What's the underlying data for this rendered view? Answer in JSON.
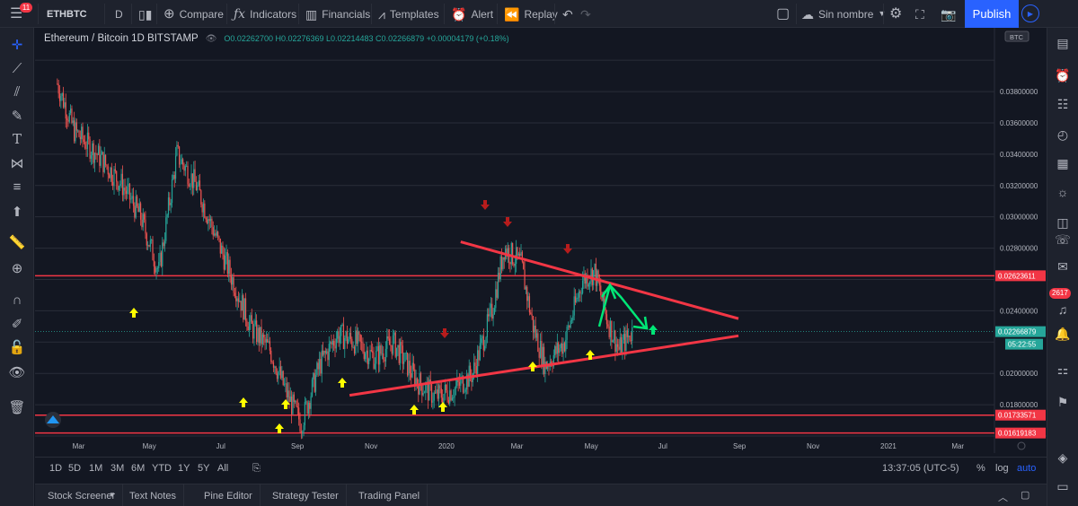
{
  "topbar": {
    "menu_badge": "11",
    "symbol": "ETHBTC",
    "interval": "D",
    "compare": "Compare",
    "indicators": "Indicators",
    "financials": "Financials",
    "templates": "Templates",
    "alert": "Alert",
    "replay": "Replay",
    "layout_name": "Sin nombre",
    "publish": "Publish"
  },
  "legend": {
    "title": "Ethereum / Bitcoin  1D  BITSTAMP",
    "ohlc": "O0.02262700  H0.02276369  L0.02214483  C0.02266879  +0.00004179 (+0.18%)"
  },
  "price_axis": {
    "currency_badge": "BTC",
    "ticks": [
      "0.03800000",
      "0.03600000",
      "0.03400000",
      "0.03200000",
      "0.03000000",
      "0.02800000",
      "0.02400000",
      "0.02000000",
      "0.01800000"
    ],
    "labels": [
      {
        "text": "0.02623611",
        "color": "#f23645"
      },
      {
        "text": "0.02266879",
        "color": "#26a69a"
      },
      {
        "text": "05:22:55",
        "color": "#26a69a"
      },
      {
        "text": "0.01733571",
        "color": "#f23645"
      },
      {
        "text": "0.01619183",
        "color": "#f23645"
      }
    ]
  },
  "time_axis": [
    "Mar",
    "May",
    "Jul",
    "Sep",
    "Nov",
    "2020",
    "Mar",
    "May",
    "Jul",
    "Sep",
    "Nov",
    "2021",
    "Mar"
  ],
  "rangebar": {
    "ranges": [
      "1D",
      "5D",
      "1M",
      "3M",
      "6M",
      "YTD",
      "1Y",
      "5Y",
      "All"
    ],
    "clock": "13:37:05 (UTC-5)",
    "percent": "%",
    "log": "log",
    "auto": "auto"
  },
  "bottom_tabs": [
    "Stock Screener",
    "Text Notes",
    "Pine Editor",
    "Strategy Tester",
    "Trading Panel"
  ],
  "right_toolbar": {
    "alerts_badge": "2617"
  },
  "colors": {
    "background": "#131722",
    "toolbar": "#1e222d",
    "up": "#26a69a",
    "down": "#ef5350",
    "trendline": "#f23645",
    "support_arrow": "#ffff00",
    "resistance_arrow": "#b71c1c",
    "projection": "#00e676",
    "accent": "#2962ff"
  },
  "chart_data": {
    "type": "candlestick",
    "symbol": "ETHBTC",
    "exchange": "BITSTAMP",
    "interval": "1D",
    "last_price": 0.02266879,
    "ylim": [
      0.016,
      0.0415
    ],
    "horizontal_levels": [
      0.02623611,
      0.01733571,
      0.01619183
    ],
    "trendlines": [
      {
        "name": "resistance",
        "from": [
          "2020-01-15",
          0.0284
        ],
        "to": [
          "2020-09-01",
          0.0235
        ]
      },
      {
        "name": "support",
        "from": [
          "2019-10-15",
          0.0186
        ],
        "to": [
          "2020-09-01",
          0.0224
        ]
      }
    ],
    "close_path": [
      [
        "2019-02-15",
        0.0385
      ],
      [
        "2019-03-01",
        0.0355
      ],
      [
        "2019-03-20",
        0.034
      ],
      [
        "2019-04-10",
        0.032
      ],
      [
        "2019-04-25",
        0.03
      ],
      [
        "2019-05-10",
        0.0265
      ],
      [
        "2019-05-25",
        0.034
      ],
      [
        "2019-06-10",
        0.032
      ],
      [
        "2019-06-25",
        0.029
      ],
      [
        "2019-07-10",
        0.026
      ],
      [
        "2019-07-25",
        0.023
      ],
      [
        "2019-08-10",
        0.0215
      ],
      [
        "2019-08-25",
        0.0185
      ],
      [
        "2019-09-05",
        0.0168
      ],
      [
        "2019-09-20",
        0.0205
      ],
      [
        "2019-10-05",
        0.0225
      ],
      [
        "2019-10-20",
        0.022
      ],
      [
        "2019-11-05",
        0.021
      ],
      [
        "2019-11-20",
        0.022
      ],
      [
        "2019-12-10",
        0.0195
      ],
      [
        "2019-12-25",
        0.0185
      ],
      [
        "2020-01-10",
        0.019
      ],
      [
        "2020-01-25",
        0.02
      ],
      [
        "2020-02-10",
        0.024
      ],
      [
        "2020-02-20",
        0.028
      ],
      [
        "2020-03-05",
        0.027
      ],
      [
        "2020-03-15",
        0.023
      ],
      [
        "2020-03-25",
        0.0205
      ],
      [
        "2020-04-10",
        0.022
      ],
      [
        "2020-04-25",
        0.026
      ],
      [
        "2020-05-05",
        0.0265
      ],
      [
        "2020-05-15",
        0.0235
      ],
      [
        "2020-05-25",
        0.0215
      ],
      [
        "2020-06-05",
        0.0227
      ]
    ]
  }
}
